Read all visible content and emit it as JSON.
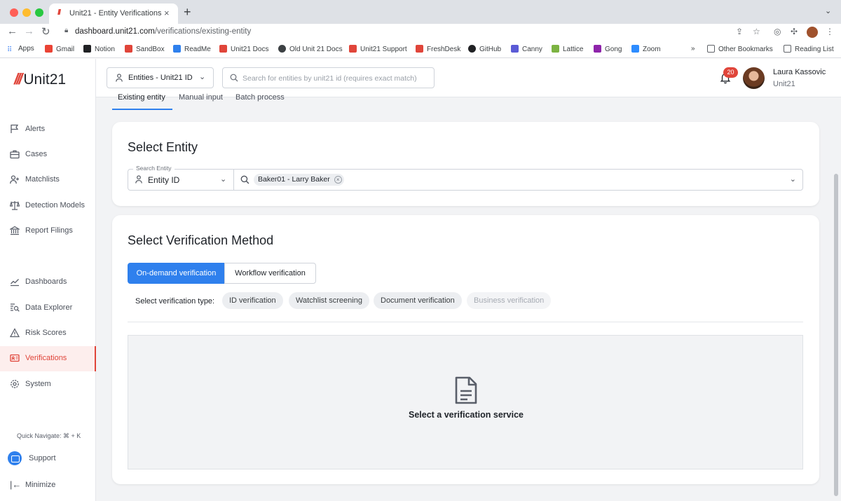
{
  "browser": {
    "tab_title": "Unit21 - Entity Verifications",
    "tab_favicon": "///",
    "close_glyph": "×",
    "new_tab_glyph": "+",
    "url_host": "dashboard.unit21.com",
    "url_path": "/verifications/existing-entity",
    "bookmarks": [
      {
        "label": "Apps",
        "icon": "apps-grid-icon",
        "color": "#4285f4"
      },
      {
        "label": "Gmail",
        "icon": "gmail-icon",
        "color": "#ea4335"
      },
      {
        "label": "Notion",
        "icon": "notion-icon",
        "color": "#202124"
      },
      {
        "label": "SandBox",
        "icon": "unit21-icon",
        "color": "#e0453a"
      },
      {
        "label": "ReadMe",
        "icon": "readme-icon",
        "color": "#2f80ed"
      },
      {
        "label": "Unit21 Docs",
        "icon": "unit21-icon",
        "color": "#e0453a"
      },
      {
        "label": "Old Unit 21 Docs",
        "icon": "globe-icon",
        "color": "#3c4043"
      },
      {
        "label": "Unit21 Support",
        "icon": "unit21-icon",
        "color": "#e0453a"
      },
      {
        "label": "FreshDesk",
        "icon": "freshdesk-icon",
        "color": "#e0453a"
      },
      {
        "label": "GitHub",
        "icon": "github-icon",
        "color": "#202124"
      },
      {
        "label": "Canny",
        "icon": "canny-icon",
        "color": "#5b5bd6"
      },
      {
        "label": "Lattice",
        "icon": "lattice-icon",
        "color": "#7cb342"
      },
      {
        "label": "Gong",
        "icon": "gong-icon",
        "color": "#8e24aa"
      },
      {
        "label": "Zoom",
        "icon": "zoom-icon",
        "color": "#2d8cff"
      }
    ],
    "overflow": "»",
    "other_bookmarks": "Other Bookmarks",
    "reading_list": "Reading List"
  },
  "sidebar": {
    "logo_mark": "///",
    "logo_text": "Unit21",
    "items": [
      {
        "label": "Alerts",
        "icon": "flag-icon"
      },
      {
        "label": "Cases",
        "icon": "briefcase-icon"
      },
      {
        "label": "Matchlists",
        "icon": "user-plus-icon"
      },
      {
        "label": "Detection Models",
        "icon": "scale-icon"
      },
      {
        "label": "Report Filings",
        "icon": "bank-icon"
      },
      {
        "label": "Dashboards",
        "icon": "line-chart-icon"
      },
      {
        "label": "Data Explorer",
        "icon": "data-search-icon"
      },
      {
        "label": "Risk Scores",
        "icon": "warning-icon"
      },
      {
        "label": "Verifications",
        "icon": "id-card-icon"
      },
      {
        "label": "System",
        "icon": "gear-icon"
      }
    ],
    "quick_navigate": "Quick Navigate: ⌘ + K",
    "support": "Support",
    "minimize": "Minimize"
  },
  "topbar": {
    "entity_selector": "Entities - Unit21 ID",
    "search_placeholder": "Search for entities by unit21 id (requires exact match)",
    "notifications_count": "20",
    "user_name": "Laura Kassovic",
    "user_org": "Unit21"
  },
  "tabs": [
    "Existing entity",
    "Manual input",
    "Batch process"
  ],
  "select_entity": {
    "title": "Select Entity",
    "field_label": "Search Entity",
    "entity_type": "Entity ID",
    "selected_chip": "Baker01 - Larry Baker"
  },
  "verification": {
    "title": "Select Verification Method",
    "mode_on": "On-demand verification",
    "mode_off": "Workflow verification",
    "type_label": "Select verification type:",
    "types": [
      {
        "label": "ID verification",
        "enabled": true
      },
      {
        "label": "Watchlist screening",
        "enabled": true
      },
      {
        "label": "Document verification",
        "enabled": true
      },
      {
        "label": "Business verification",
        "enabled": false
      }
    ],
    "empty_text": "Select a verification service"
  },
  "colors": {
    "brand": "#e0453a",
    "accent": "#2f80ed"
  }
}
